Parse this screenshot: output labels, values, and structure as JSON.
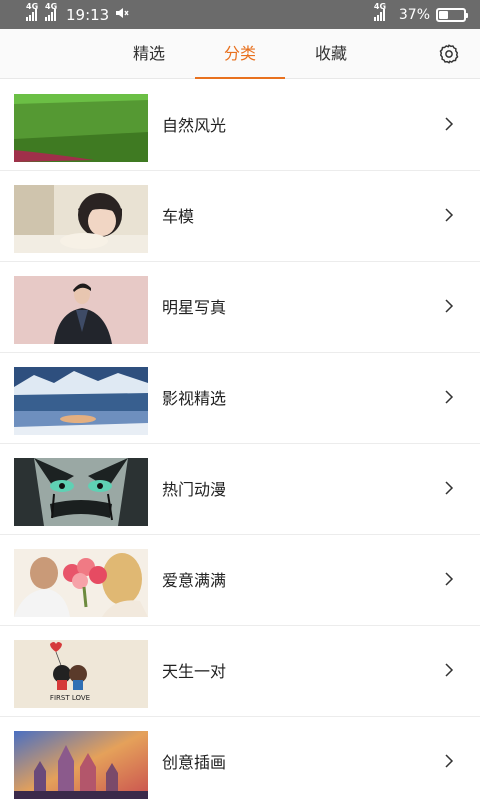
{
  "status_bar": {
    "network1": "4G",
    "network2": "4G",
    "time": "19:13",
    "network3": "4G",
    "battery_pct": "37%",
    "battery_level": 0.37
  },
  "tabs": [
    {
      "label": "精选",
      "active": false
    },
    {
      "label": "分类",
      "active": true
    },
    {
      "label": "收藏",
      "active": false
    }
  ],
  "accent_color": "#e8711f",
  "categories": [
    {
      "label": "自然风光",
      "thumb": "green-field"
    },
    {
      "label": "车模",
      "thumb": "girl-portrait"
    },
    {
      "label": "明星写真",
      "thumb": "man-portrait"
    },
    {
      "label": "影视精选",
      "thumb": "winter-lake"
    },
    {
      "label": "热门动漫",
      "thumb": "anime-face"
    },
    {
      "label": "爱意满满",
      "thumb": "couple-flowers"
    },
    {
      "label": "天生一对",
      "thumb": "first-love",
      "thumb_text": "FIRST LOVE"
    },
    {
      "label": "创意插画",
      "thumb": "castle-illustration"
    }
  ]
}
